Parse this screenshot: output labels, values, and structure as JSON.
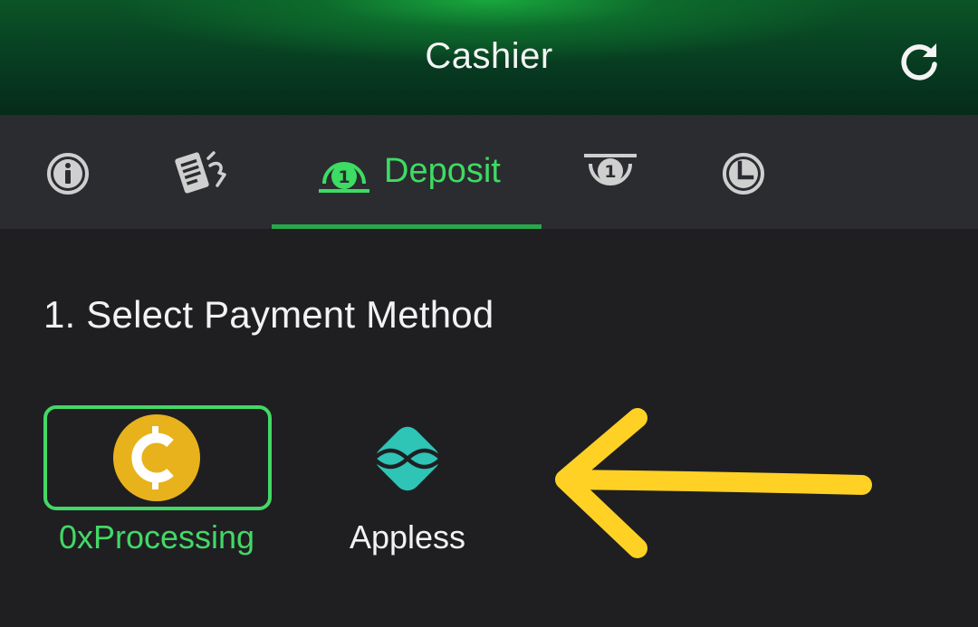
{
  "header": {
    "title": "Cashier",
    "refresh_icon": "refresh-icon"
  },
  "tabs": {
    "items": [
      {
        "icon": "info-icon",
        "label": ""
      },
      {
        "icon": "document-icon",
        "label": ""
      },
      {
        "icon": "deposit-icon",
        "label": "Deposit",
        "active": true
      },
      {
        "icon": "withdraw-icon",
        "label": ""
      },
      {
        "icon": "history-icon",
        "label": ""
      }
    ],
    "active_color": "#3ddc63"
  },
  "main": {
    "section_title": "1. Select Payment Method",
    "methods": [
      {
        "label": "0xProcessing",
        "icon": "crypto-coin-icon",
        "selected": true
      },
      {
        "label": "Appless",
        "icon": "appless-logo-icon",
        "selected": false
      }
    ],
    "annotation": {
      "icon": "arrow-left-icon",
      "color": "#ffd125"
    }
  },
  "colors": {
    "accent": "#43d866",
    "background": "#1f1f22",
    "tabbar": "#2b2c30",
    "coin": "#e8b21c",
    "appless": "#2ec4b6"
  }
}
